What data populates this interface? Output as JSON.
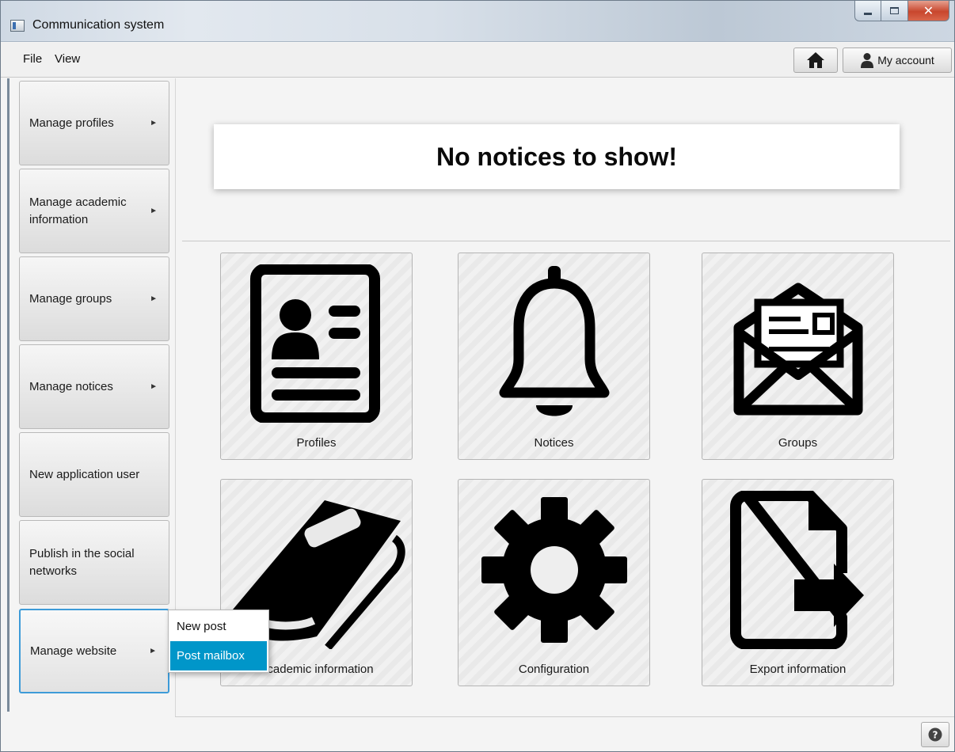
{
  "window": {
    "title": "Communication system"
  },
  "menubar": {
    "file": "File",
    "view": "View",
    "my_account": "My account"
  },
  "sidebar": {
    "items": [
      {
        "label": "Manage profiles",
        "has_submenu": true
      },
      {
        "label": "Manage academic information",
        "has_submenu": true
      },
      {
        "label": "Manage groups",
        "has_submenu": true
      },
      {
        "label": "Manage notices",
        "has_submenu": true
      },
      {
        "label": "New application user",
        "has_submenu": false
      },
      {
        "label": "Publish in the social networks",
        "has_submenu": false
      },
      {
        "label": "Manage website",
        "has_submenu": true,
        "active": true
      }
    ]
  },
  "main": {
    "notice_text": "No notices to show!",
    "tiles": [
      {
        "label": "Profiles",
        "icon": "profile-card-icon"
      },
      {
        "label": "Notices",
        "icon": "bell-icon"
      },
      {
        "label": "Groups",
        "icon": "envelope-icon"
      },
      {
        "label": "Academic information",
        "icon": "book-icon"
      },
      {
        "label": "Configuration",
        "icon": "gear-icon"
      },
      {
        "label": "Export information",
        "icon": "file-export-icon"
      }
    ]
  },
  "popup": {
    "items": [
      {
        "label": "New post",
        "selected": false
      },
      {
        "label": "Post mailbox",
        "selected": true
      }
    ]
  },
  "colors": {
    "accent": "#0096c9",
    "active_border": "#3d9bd8"
  }
}
